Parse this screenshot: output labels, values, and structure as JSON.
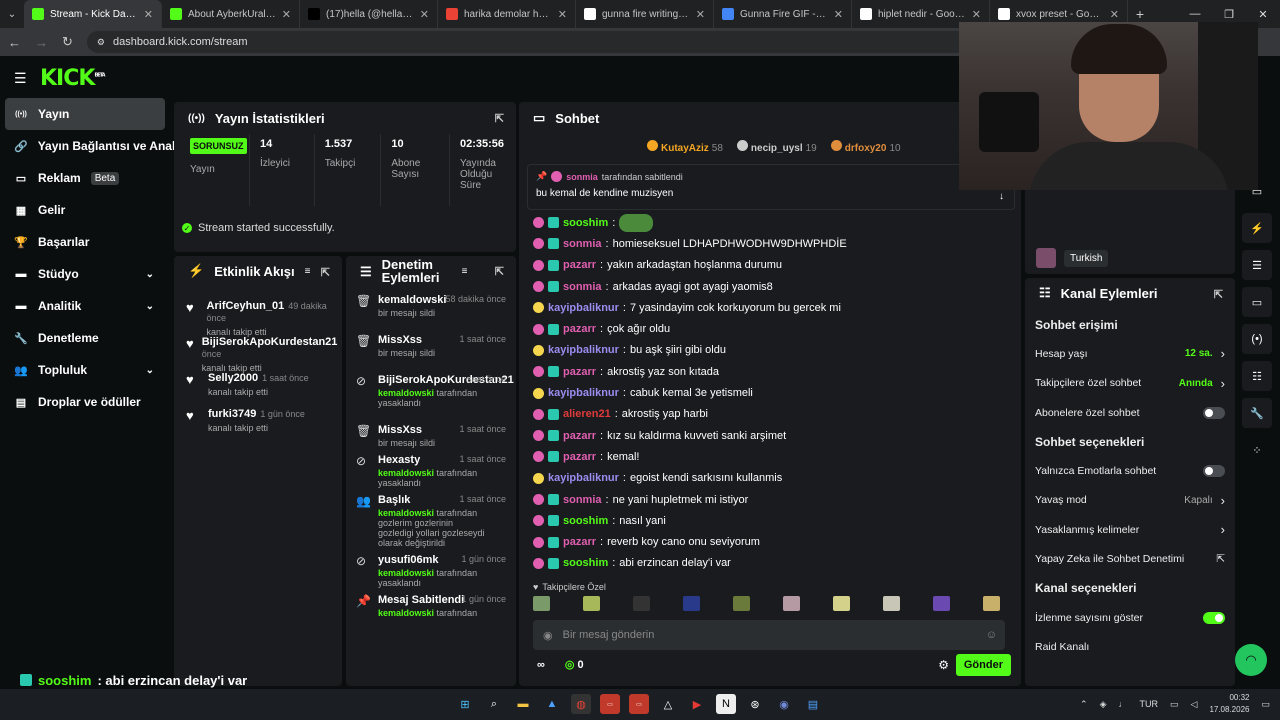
{
  "browser": {
    "tabs": [
      {
        "title": "Stream - Kick Dashboard",
        "color": "#53fc18",
        "active": true
      },
      {
        "title": "About AyberkUral - Watch",
        "color": "#53fc18"
      },
      {
        "title": "(17)hella (@hellatheluv) |",
        "color": "#000000"
      },
      {
        "title": "harika demolar hepsini de",
        "color": "#ea4335"
      },
      {
        "title": "gunna fire writing - Goog",
        "color": "#ffffff"
      },
      {
        "title": "Gunna Fire GIF - Gunna F",
        "color": "#4285f4"
      },
      {
        "title": "hiplet nedir - Google'da A",
        "color": "#ffffff"
      },
      {
        "title": "xvox preset - Google'da A",
        "color": "#ffffff"
      }
    ],
    "url": "dashboard.kick.com/stream"
  },
  "logo": "KICK",
  "logo_sup": "BETA",
  "sidebar": {
    "items": [
      {
        "label": "Yayın",
        "icon": "broadcast-icon",
        "glyph": "((•))"
      },
      {
        "label": "Yayın Bağlantısı ve Anahtarı",
        "icon": "link-icon",
        "glyph": "🔗"
      },
      {
        "label": "Reklam",
        "badge": "Beta",
        "icon": "ad-icon",
        "glyph": "▭"
      },
      {
        "label": "Gelir",
        "icon": "revenue-icon",
        "glyph": "▦"
      },
      {
        "label": "Başarılar",
        "icon": "trophy-icon",
        "glyph": "🏆"
      },
      {
        "label": "Stüdyo",
        "icon": "studio-icon",
        "glyph": "▬"
      },
      {
        "label": "Analitik",
        "icon": "analytics-icon",
        "glyph": "▬"
      },
      {
        "label": "Denetleme",
        "icon": "wrench-icon",
        "glyph": "🔧"
      },
      {
        "label": "Topluluk",
        "icon": "community-icon",
        "glyph": "👥"
      },
      {
        "label": "Droplar ve ödüller",
        "icon": "gift-icon",
        "glyph": "▤"
      }
    ]
  },
  "stats": {
    "title": "Yayın İstatistikleri",
    "status_badge": "SORUNSUZ",
    "items": [
      {
        "label": "Yayın",
        "value": ""
      },
      {
        "label": "İzleyici",
        "value": "14"
      },
      {
        "label": "Takipçi",
        "value": "1.537"
      },
      {
        "label": "Abone Sayısı",
        "value": "10"
      },
      {
        "label": "Yayında Olduğu Süre",
        "value": "02:35:56"
      }
    ],
    "success_msg": "Stream started successfully."
  },
  "activity": {
    "title": "Etkinlik Akışı",
    "items": [
      {
        "name": "ArifCeyhun_01",
        "time": "49 dakika önce",
        "sub": "kanalı takip etti"
      },
      {
        "name": "BijiSerokApoKurdestan21",
        "time": "saat önce",
        "sub": "kanalı takip etti"
      },
      {
        "name": "Selly2000",
        "time": "1 saat önce",
        "sub": "kanalı takip etti"
      },
      {
        "name": "furki3749",
        "time": "1 gün önce",
        "sub": "kanalı takip etti"
      }
    ]
  },
  "moderation": {
    "title": "Denetim Eylemleri",
    "items": [
      {
        "name": "kemaldowski",
        "time": "58 dakika önce",
        "sub": "bir mesajı sildi",
        "glyph": "🗑"
      },
      {
        "name": "MissXss",
        "time": "1 saat önce",
        "sub": "bir mesajı sildi",
        "glyph": "🗑"
      },
      {
        "name": "BijiSerokApoKurdestan21",
        "time": "saat önce",
        "mod": "kemaldowski",
        "sub": "tarafından yasaklandı",
        "glyph": "⊘"
      },
      {
        "name": "MissXss",
        "time": "1 saat önce",
        "sub": "bir mesajı sildi",
        "glyph": "🗑"
      },
      {
        "name": "Hexasty",
        "time": "1 saat önce",
        "mod": "kemaldowski",
        "sub": "tarafından yasaklandı",
        "glyph": "⊘"
      },
      {
        "name": "Başlık",
        "time": "1 saat önce",
        "mod": "kemaldowski",
        "sub": "tarafından gozlerim gozlerinin gozledigi yollari gozleseydi olarak değiştirildi",
        "glyph": "👥"
      },
      {
        "name": "yusufi06mk",
        "time": "1 gün önce",
        "mod": "kemaldowski",
        "sub": "tarafından yasaklandı",
        "glyph": "⊘"
      },
      {
        "name": "Mesaj Sabitlendi",
        "time": "1 gün önce",
        "mod": "kemaldowski",
        "sub": "tarafından",
        "glyph": "📌"
      }
    ]
  },
  "chat": {
    "title": "Sohbet",
    "gifters": [
      {
        "name": "KutayAziz",
        "count": "58",
        "color": "#f5a623"
      },
      {
        "name": "necip_uysl",
        "count": "19",
        "color": "#cccccc"
      },
      {
        "name": "drfoxy20",
        "count": "10",
        "color": "#e08d3c"
      }
    ],
    "pinned_by": "sonmia",
    "pinned_label": "tarafından sabitlendi",
    "pinned_msg": "bu kemal de kendine muzisyen",
    "messages": [
      {
        "user": "sooshim",
        "color": "#53fc18",
        "text": "",
        "emote": true
      },
      {
        "user": "sonmia",
        "color": "#e05fb0",
        "text": "homieseksuel LDHAPDHWODHW9DHWPHDİE"
      },
      {
        "user": "pazarr",
        "color": "#e05fb0",
        "text": "yakın arkadaştan hoşlanma durumu"
      },
      {
        "user": "sonmia",
        "color": "#e05fb0",
        "text": "arkadas ayagi got ayagi yaomis8"
      },
      {
        "user": "kayipbaliknur",
        "color": "#9c8cf0",
        "text": "7 yasindayim cok korkuyorum bu gercek mi"
      },
      {
        "user": "pazarr",
        "color": "#e05fb0",
        "text": "çok ağır oldu"
      },
      {
        "user": "kayipbaliknur",
        "color": "#9c8cf0",
        "text": "bu aşk şiiri gibi oldu"
      },
      {
        "user": "pazarr",
        "color": "#e05fb0",
        "text": "akrostiş yaz son kıtada"
      },
      {
        "user": "kayipbaliknur",
        "color": "#9c8cf0",
        "text": "cabuk kemal 3e yetismeli"
      },
      {
        "user": "alieren21",
        "color": "#e03b3b",
        "text": "akrostiş yap harbi"
      },
      {
        "user": "pazarr",
        "color": "#e05fb0",
        "text": "kız su kaldırma kuvveti sanki arşimet"
      },
      {
        "user": "pazarr",
        "color": "#e05fb0",
        "text": "kemal!"
      },
      {
        "user": "kayipbaliknur",
        "color": "#9c8cf0",
        "text": "egoist kendi sarkısını kullanmis"
      },
      {
        "user": "sonmia",
        "color": "#e05fb0",
        "text": "ne yani hupletmek mi istiyor"
      },
      {
        "user": "sooshim",
        "color": "#53fc18",
        "text": "nasıl yani"
      },
      {
        "user": "pazarr",
        "color": "#e05fb0",
        "text": "reverb koy cano onu seviyorum"
      },
      {
        "user": "sooshim",
        "color": "#53fc18",
        "text": "abi erzincan delay'i var"
      }
    ],
    "followers_only": "Takipçilere Özel",
    "input_placeholder": "Bir mesaj gönderin",
    "points": "0",
    "send": "Gönder"
  },
  "channel_actions": {
    "title": "Kanal Eylemleri",
    "language": "Turkish",
    "rows": [
      {
        "label": "Sohbet erişimi",
        "type": "header"
      },
      {
        "label": "Hesap yaşı",
        "value": "12 sa.",
        "type": "chev"
      },
      {
        "label": "Takipçilere özel sohbet",
        "value": "Anında",
        "type": "chev"
      },
      {
        "label": "Abonelere özel sohbet",
        "type": "toggle",
        "on": false
      },
      {
        "label": "Sohbet seçenekleri",
        "type": "header"
      },
      {
        "label": "Yalnızca Emotlarla sohbet",
        "type": "toggle",
        "on": false
      },
      {
        "label": "Yavaş mod",
        "value": "Kapalı",
        "type": "chev-gray"
      },
      {
        "label": "Yasaklanmış kelimeler",
        "type": "chev"
      },
      {
        "label": "Yapay Zeka ile Sohbet Denetimi",
        "type": "ext"
      },
      {
        "label": "Kanal seçenekleri",
        "type": "header"
      },
      {
        "label": "İzlenme sayısını göster",
        "type": "toggle",
        "on": true
      },
      {
        "label": "Raid Kanalı",
        "type": "none"
      }
    ]
  },
  "overlay": {
    "user": "sooshim",
    "text": ": abi erzincan delay'i var"
  },
  "taskbar": {
    "lang": "TUR",
    "time": "00:32",
    "date": "17.08.2026"
  }
}
